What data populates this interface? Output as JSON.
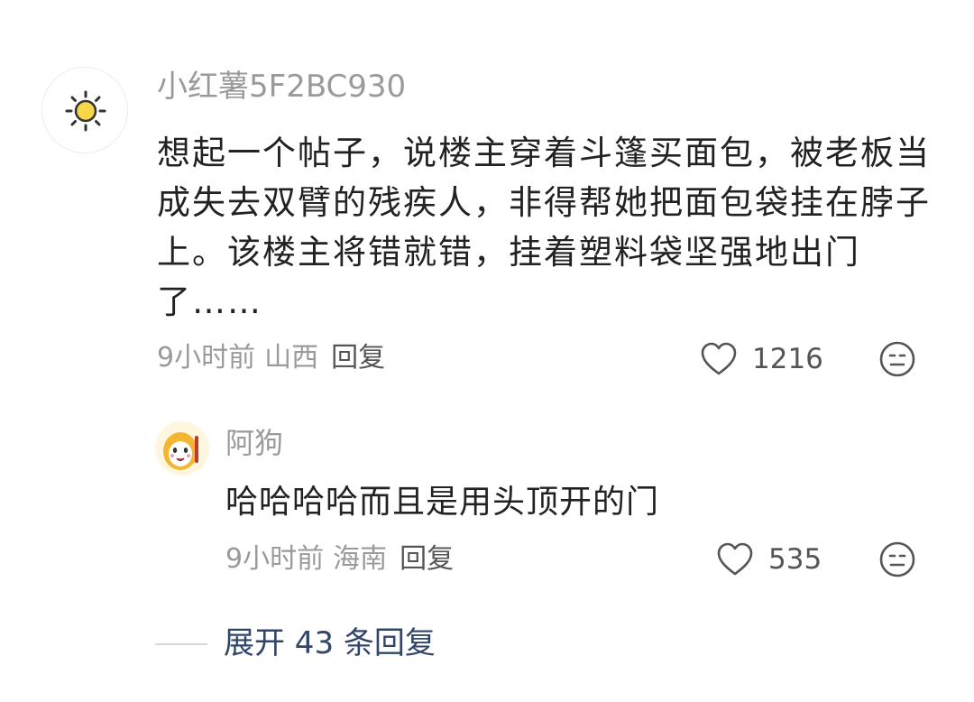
{
  "main_comment": {
    "avatar_icon": "sun-icon",
    "username": "小红薯5F2BC930",
    "content": "想起一个帖子，说楼主穿着斗篷买面包，被老板当成失去双臂的残疾人，非得帮她把面包袋挂在脖子上。该楼主将错就错，挂着塑料袋坚强地出门了……",
    "time": "9小时前",
    "location": "山西",
    "reply_label": "回复",
    "likes": "1216",
    "like_icon": "heart-outline-icon",
    "dislike_icon": "meh-face-icon"
  },
  "reply_comment": {
    "avatar_icon": "cartoon-dog-avatar",
    "username": "阿狗",
    "content": "哈哈哈哈而且是用头顶开的门",
    "time": "9小时前",
    "location": "海南",
    "reply_label": "回复",
    "likes": "535",
    "like_icon": "heart-outline-icon",
    "dislike_icon": "meh-face-icon"
  },
  "expand": {
    "label": "展开 43 条回复"
  },
  "colors": {
    "text_primary": "#222222",
    "text_secondary": "#9a9a9a",
    "link_blue": "#31456b",
    "sun_yellow": "#f7d64a"
  }
}
